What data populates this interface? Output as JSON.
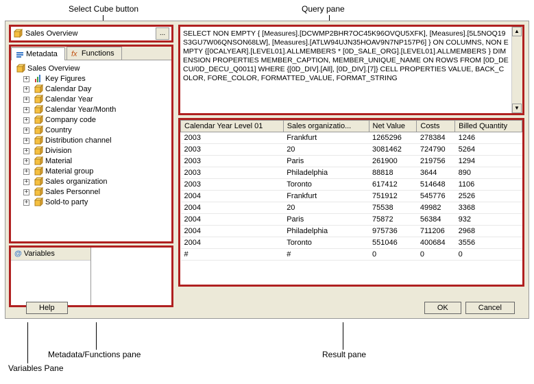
{
  "callouts": {
    "select_cube": "Select Cube button",
    "query_pane": "Query pane",
    "metadata_functions": "Metadata/Functions pane",
    "variables_pane": "Variables Pane",
    "result_pane": "Result pane"
  },
  "cube_selector": {
    "value": "Sales Overview",
    "browse": "..."
  },
  "tabs": {
    "metadata": "Metadata",
    "functions": "Functions"
  },
  "tree": {
    "root": "Sales Overview",
    "items": [
      "Key Figures",
      "Calendar Day",
      "Calendar Year",
      "Calendar Year/Month",
      "Company code",
      "Country",
      "Distribution channel",
      "Division",
      "Material",
      "Material group",
      "Sales organization",
      "Sales Personnel",
      "Sold-to party"
    ]
  },
  "variables": {
    "label": "Variables"
  },
  "query": {
    "text": "SELECT NON EMPTY { [Measures].[DCWMP2BHR7OC45K96OVQU5XFK], [Measures].[5L5NOQ19S3GU7W06QNSON68LW], [Measures].[ATLW94UJN35HOAV9N7NP157P6] } ON COLUMNS, NON EMPTY {[0CALYEAR].[LEVEL01].ALLMEMBERS * [0D_SALE_ORG].[LEVEL01].ALLMEMBERS } DIMENSION PROPERTIES MEMBER_CAPTION, MEMBER_UNIQUE_NAME ON ROWS FROM [0D_DECU/0D_DECU_Q0011] WHERE {[0D_DIV].[All], [0D_DIV].[7]} CELL PROPERTIES VALUE, BACK_COLOR, FORE_COLOR, FORMATTED_VALUE, FORMAT_STRING"
  },
  "result": {
    "headers": [
      "Calendar Year Level 01",
      "Sales organizatio...",
      "Net Value",
      "Costs",
      "Billed Quantity"
    ],
    "rows": [
      [
        "2003",
        "Frankfurt",
        "1265296",
        "278384",
        "1246"
      ],
      [
        "2003",
        "20",
        "3081462",
        "724790",
        "5264"
      ],
      [
        "2003",
        "Paris",
        "261900",
        "219756",
        "1294"
      ],
      [
        "2003",
        "Philadelphia",
        "88818",
        "3644",
        "890"
      ],
      [
        "2003",
        "Toronto",
        "617412",
        "514648",
        "1106"
      ],
      [
        "2004",
        "Frankfurt",
        "751912",
        "545776",
        "2526"
      ],
      [
        "2004",
        "20",
        "75538",
        "49982",
        "3368"
      ],
      [
        "2004",
        "Paris",
        "75872",
        "56384",
        "932"
      ],
      [
        "2004",
        "Philadelphia",
        "975736",
        "711206",
        "2968"
      ],
      [
        "2004",
        "Toronto",
        "551046",
        "400684",
        "3556"
      ],
      [
        "#",
        "#",
        "0",
        "0",
        "0"
      ]
    ]
  },
  "buttons": {
    "help": "Help",
    "ok": "OK",
    "cancel": "Cancel"
  }
}
